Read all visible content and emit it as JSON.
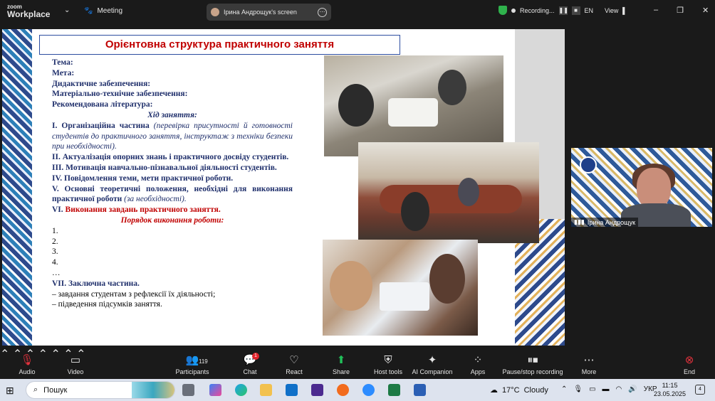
{
  "topbar": {
    "brand_top": "zoom",
    "brand_bottom": "Workplace",
    "meeting_label": "Meeting",
    "share_label": "Ірина Андрощук's screen",
    "recording_label": "Recording...",
    "language": "EN",
    "view_label": "View"
  },
  "slide": {
    "title": "Орієнтовна структура практичного заняття",
    "lines": [
      {
        "style": "b",
        "text": "Тема:"
      },
      {
        "style": "b",
        "text": "Мета:"
      },
      {
        "style": "b",
        "text": "Дидактичне забезпечення:"
      },
      {
        "style": "b",
        "text": "Матеріально-технічне забезпечення:"
      },
      {
        "style": "b",
        "text": "Рекомендована література:"
      },
      {
        "style": "c",
        "text": "Хід заняття:"
      },
      {
        "style": "j",
        "text_b": "І. Організаційна частина",
        "text_i": "(перевірка присутності й готовності студентів до практичного заняття, інструктаж з техніки безпеки при необхідності)."
      },
      {
        "style": "bj",
        "text": "ІІ. Актуалізація опорних знань і практичного досвіду студентів."
      },
      {
        "style": "b",
        "text": "ІІІ. Мотивація навчально-пізнавальної діяльності студентів."
      },
      {
        "style": "b",
        "text": "IV. Повідомлення теми, мети практичної роботи."
      },
      {
        "style": "j",
        "text_b": "V. Основні теоретичні положення, необхідні для виконання практичної роботи",
        "text_i": "(за необхідності)."
      },
      {
        "style": "r",
        "text_b": "VI.",
        "text_r": "Виконання завдань практичного заняття."
      },
      {
        "style": "rc",
        "text": "Порядок виконання роботи:"
      },
      {
        "style": "k",
        "text": "1."
      },
      {
        "style": "k",
        "text": "2."
      },
      {
        "style": "k",
        "text": "3."
      },
      {
        "style": "k",
        "text": "4."
      },
      {
        "style": "k",
        "text": "…"
      },
      {
        "style": "b",
        "text": "VII. Заключна частина."
      },
      {
        "style": "k",
        "text": "–    завдання студентам з рефлексії їх діяльності;"
      },
      {
        "style": "k",
        "text": "–    підведення підсумків заняття."
      }
    ]
  },
  "participant_video": {
    "name": "Ірина Андрощук"
  },
  "toolbar": {
    "audio": "Audio",
    "video": "Video",
    "participants": "Participants",
    "participants_count": "119",
    "chat": "Chat",
    "chat_badge": "1",
    "react": "React",
    "share": "Share",
    "host_tools": "Host tools",
    "ai_companion": "AI Companion",
    "apps": "Apps",
    "pause_recording": "Pause/stop recording",
    "more": "More",
    "end": "End"
  },
  "taskbar": {
    "search_placeholder": "Пошук",
    "weather_temp": "17°C",
    "weather_text": "Cloudy",
    "lang": "УКР",
    "time": "11:15",
    "date": "23.05.2025",
    "notifications": "4"
  },
  "colors": {
    "accent_red": "#c00000",
    "slide_text": "#1f2f6b",
    "title_border": "#2c4da0",
    "record_shield": "#2fb24c",
    "end_button": "#e5323d"
  }
}
